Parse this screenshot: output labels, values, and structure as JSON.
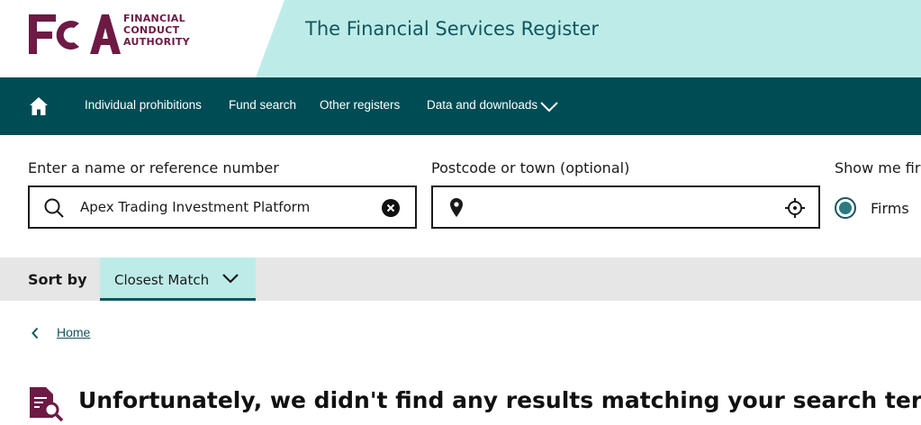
{
  "header": {
    "logo_letters": "FCA",
    "logo_lines": [
      "FINANCIAL",
      "CONDUCT",
      "AUTHORITY"
    ],
    "site_title": "The Financial Services Register"
  },
  "nav": {
    "home_icon": "home-icon",
    "items": [
      {
        "label": "Individual prohibitions"
      },
      {
        "label": "Fund search"
      },
      {
        "label": "Other registers"
      },
      {
        "label": "Data and downloads"
      }
    ],
    "dropdown_icon": "chevron-down-icon"
  },
  "search": {
    "name_label": "Enter a name or reference number",
    "name_value": "Apex Trading Investment Platform",
    "postcode_label": "Postcode or town (optional)",
    "postcode_value": "",
    "show_label": "Show me fir",
    "radio_label": "Firms"
  },
  "sort": {
    "label": "Sort by",
    "selected": "Closest Match"
  },
  "breadcrumb": {
    "home_label": "Home"
  },
  "results": {
    "no_results_title": "Unfortunately, we didn't find any results matching your search term"
  },
  "colors": {
    "brand_purple": "#6d1a45",
    "teal_dark": "#004c54",
    "teal_light": "#bdece8",
    "teal_text": "#12555d",
    "sort_bar_grey": "#e6e6e6"
  }
}
